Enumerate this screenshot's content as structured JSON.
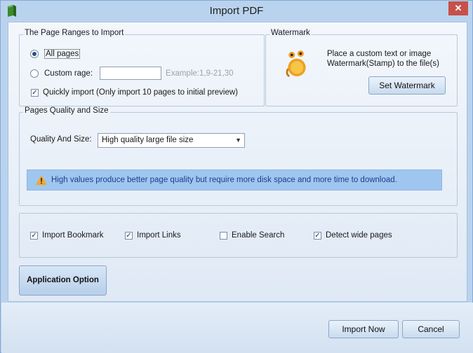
{
  "window": {
    "title": "Import PDF",
    "close_glyph": "✕"
  },
  "page_ranges": {
    "title": "The Page Ranges to Import",
    "all_pages_label": "All pages",
    "custom_range_label": "Custom rage:",
    "custom_range_value": "",
    "custom_range_example": "Example:1,9-21,30",
    "quick_import_label": "Quickly import (Only import 10 pages to  initial  preview)",
    "all_pages_selected": true,
    "quick_import_checked": true
  },
  "watermark": {
    "title": "Watermark",
    "description_line1": "Place a custom text or image",
    "description_line2": "Watermark(Stamp) to the file(s)",
    "button_label": "Set Watermark"
  },
  "quality": {
    "title": "Pages Quality and Size",
    "label": "Quality And Size:",
    "selected": "High quality large file size",
    "info": "High values produce better page quality but require more disk space and more time to download."
  },
  "options": [
    {
      "label": "Import Bookmark",
      "checked": true
    },
    {
      "label": "Import Links",
      "checked": true
    },
    {
      "label": "Enable Search",
      "checked": false
    },
    {
      "label": "Detect wide pages",
      "checked": true
    }
  ],
  "application_option_label": "Application Option",
  "footer": {
    "import_label": "Import Now",
    "cancel_label": "Cancel"
  },
  "check_glyph": "✓",
  "icons": [
    "book-icon",
    "gimp-watermark-icon",
    "warning-icon",
    "close-icon"
  ]
}
